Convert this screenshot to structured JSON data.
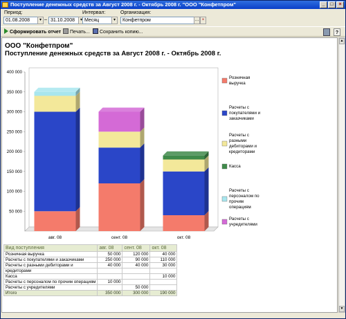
{
  "window": {
    "title": "Поступление денежных средств за Август 2008 г. - Октябрь 2008 г. \"ООО \"Конфетпром\"",
    "minimize": "_",
    "maximize": "□",
    "close": "×"
  },
  "params": {
    "period_label": "Период:",
    "date_from": "01.08.2008",
    "date_sep": "–",
    "date_to": "31.10.2008",
    "dots": "...",
    "interval_label": "Интервал:",
    "interval_value": "Месяц",
    "org_label": "Организация:",
    "org_value": "Конфетпром"
  },
  "toolbar": {
    "generate": "Сформировать отчет",
    "print": "Печать...",
    "save_copy": "Сохранить копию..."
  },
  "report": {
    "org": "ООО \"Конфетпром\"",
    "title": "Поступление денежных средств за Август 2008 г. - Октябрь 2008 г."
  },
  "chart_data": {
    "type": "bar",
    "stacked": true,
    "three_d": true,
    "categories": [
      "авг. 08",
      "сент. 08",
      "окт. 08"
    ],
    "ylim": [
      0,
      400000
    ],
    "yticks": [
      "400 000",
      "350 000",
      "300 000",
      "250 000",
      "200 000",
      "150 000",
      "100 000",
      "50 000"
    ],
    "legend_position": "right",
    "series": [
      {
        "name": "Розничная выручка",
        "values": [
          50000,
          120000,
          40000
        ],
        "color": "#f47b6b"
      },
      {
        "name": "Расчеты с покупателями и заказчиками",
        "values": [
          250000,
          90000,
          110000
        ],
        "color": "#2a46c8"
      },
      {
        "name": "Расчеты с разными дебиторами и кредиторами",
        "values": [
          40000,
          40000,
          30000
        ],
        "color": "#f3e89a"
      },
      {
        "name": "Касса",
        "values": [
          0,
          0,
          10000
        ],
        "color": "#3f8a4a"
      },
      {
        "name": "Расчеты с персоналом по прочим операциям",
        "values": [
          10000,
          0,
          0
        ],
        "color": "#a8e6ee"
      },
      {
        "name": "Расчеты с учредителями",
        "values": [
          0,
          50000,
          0
        ],
        "color": "#d46ad6"
      }
    ],
    "legend_lines": [
      [
        "Розничная",
        "выручка"
      ],
      [
        "Расчеты с",
        "покупателями и",
        "заказчиками"
      ],
      [
        "Расчеты с",
        "разными",
        "дебиторами и",
        "кредиторами"
      ],
      [
        "Касса"
      ],
      [
        "Расчеты с",
        "персоналом по",
        "прочим",
        "операциям"
      ],
      [
        "Расчеты с",
        "учредителями"
      ]
    ]
  },
  "table": {
    "header": [
      "Вид поступления",
      "авг. 08",
      "сент. 08",
      "окт. 08"
    ],
    "rows": [
      [
        "Розничная выручка",
        "50 000",
        "120 000",
        "40 000"
      ],
      [
        "Расчеты с покупателями и заказчиками",
        "250 000",
        "90 000",
        "110 000"
      ],
      [
        "Расчеты с разными дебиторами и",
        "40 000",
        "40 000",
        "30 000"
      ],
      [
        "кредиторами",
        "",
        "",
        ""
      ],
      [
        "Касса",
        "",
        "",
        "10 000"
      ],
      [
        "Расчеты с персоналом по прочим операциям",
        "10 000",
        "",
        ""
      ],
      [
        "Расчеты с учредителями",
        "",
        "50 000",
        ""
      ]
    ],
    "total": [
      "Итого",
      "350 000",
      "300 000",
      "190 000"
    ]
  }
}
